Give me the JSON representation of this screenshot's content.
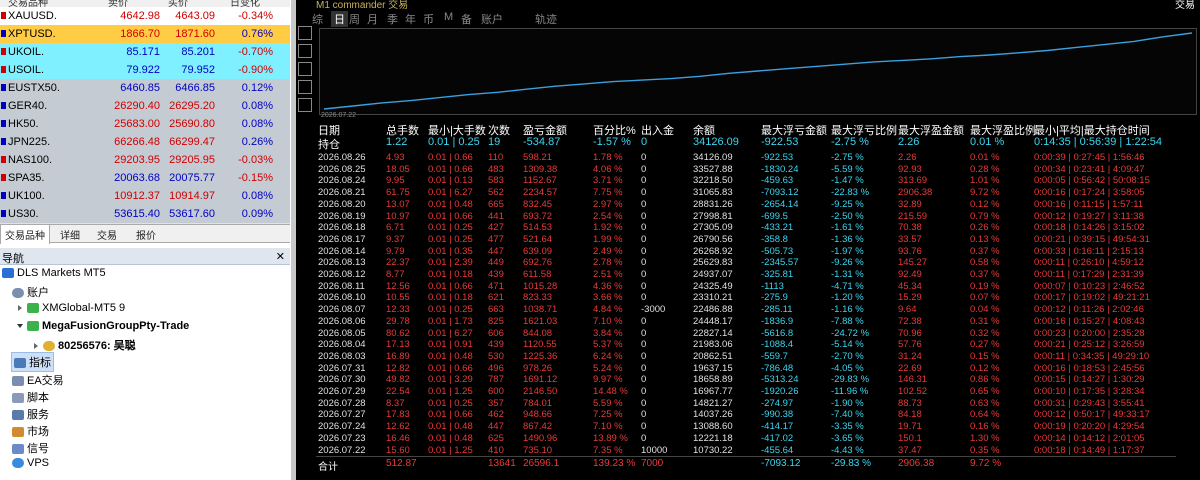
{
  "market_watch": {
    "headers": [
      "交易品种",
      "卖价",
      "买价",
      "日变化"
    ],
    "rows": [
      {
        "symbol": "XAUUSD.",
        "bid": "4642.98",
        "ask": "4643.09",
        "change": "-0.34%",
        "bg": "#ffffff",
        "bid_color": "#d00000",
        "ask_color": "#d00000",
        "chg_color": "#d00000"
      },
      {
        "symbol": "XPTUSD.",
        "bid": "1866.70",
        "ask": "1871.60",
        "change": "0.76%",
        "bg": "#ffcc44",
        "bid_color": "#d00000",
        "ask_color": "#d00000",
        "chg_color": "#0000c0"
      },
      {
        "symbol": "UKOIL.",
        "bid": "85.171",
        "ask": "85.201",
        "change": "-0.70%",
        "bg": "#7ff0ff",
        "bid_color": "#0000c0",
        "ask_color": "#0000c0",
        "chg_color": "#d00000"
      },
      {
        "symbol": "USOIL.",
        "bid": "79.922",
        "ask": "79.952",
        "change": "-0.90%",
        "bg": "#7ff0ff",
        "bid_color": "#0000c0",
        "ask_color": "#0000c0",
        "chg_color": "#d00000"
      },
      {
        "symbol": "EUSTX50.",
        "bid": "6460.85",
        "ask": "6466.85",
        "change": "0.12%",
        "bg": "#c4cbd3",
        "bid_color": "#0000c0",
        "ask_color": "#0000c0",
        "chg_color": "#0000c0"
      },
      {
        "symbol": "GER40.",
        "bid": "26290.40",
        "ask": "26295.20",
        "change": "0.08%",
        "bg": "#c4cbd3",
        "bid_color": "#d00000",
        "ask_color": "#d00000",
        "chg_color": "#0000c0"
      },
      {
        "symbol": "HK50.",
        "bid": "25683.00",
        "ask": "25690.80",
        "change": "0.08%",
        "bg": "#c4cbd3",
        "bid_color": "#d00000",
        "ask_color": "#d00000",
        "chg_color": "#0000c0"
      },
      {
        "symbol": "JPN225.",
        "bid": "66266.48",
        "ask": "66299.47",
        "change": "0.26%",
        "bg": "#c4cbd3",
        "bid_color": "#d00000",
        "ask_color": "#d00000",
        "chg_color": "#0000c0"
      },
      {
        "symbol": "NAS100.",
        "bid": "29203.95",
        "ask": "29205.95",
        "change": "-0.03%",
        "bg": "#c4cbd3",
        "bid_color": "#d00000",
        "ask_color": "#d00000",
        "chg_color": "#d00000"
      },
      {
        "symbol": "SPA35.",
        "bid": "20063.68",
        "ask": "20075.77",
        "change": "-0.15%",
        "bg": "#c4cbd3",
        "bid_color": "#0000c0",
        "ask_color": "#0000c0",
        "chg_color": "#d00000"
      },
      {
        "symbol": "UK100.",
        "bid": "10912.37",
        "ask": "10914.97",
        "change": "0.08%",
        "bg": "#c4cbd3",
        "bid_color": "#d00000",
        "ask_color": "#d00000",
        "chg_color": "#0000c0"
      },
      {
        "symbol": "US30.",
        "bid": "53615.40",
        "ask": "53617.60",
        "change": "0.09%",
        "bg": "#c4cbd3",
        "bid_color": "#0000c0",
        "ask_color": "#0000c0",
        "chg_color": "#0000c0"
      }
    ],
    "tabs": [
      "交易品种",
      "详细",
      "交易",
      "报价"
    ]
  },
  "navigator": {
    "title": "导航",
    "items": [
      {
        "label": "DLS Markets MT5",
        "bold": false
      },
      {
        "label": "账户",
        "bold": false
      },
      {
        "label": "XMGlobal-MT5 9",
        "bold": false
      },
      {
        "label": "MegaFusionGroupPty-Trade",
        "bold": true
      },
      {
        "label": "80256576: 吴聪",
        "bold": true
      },
      {
        "label": "指标",
        "bold": false
      },
      {
        "label": "EA交易",
        "bold": false
      },
      {
        "label": "脚本",
        "bold": false
      },
      {
        "label": "服务",
        "bold": false
      },
      {
        "label": "市场",
        "bold": false
      },
      {
        "label": "信号",
        "bold": false
      },
      {
        "label": "VPS",
        "bold": false
      }
    ]
  },
  "chart": {
    "title": "M1 commander 交易",
    "right": "交易",
    "periods": [
      "综",
      "日",
      "周",
      "月",
      "季",
      "年",
      "币",
      "M",
      "备",
      "账户",
      "轨迹"
    ],
    "equity_date": "2026.07.22",
    "equity_curve": [
      0,
      0.04,
      0.08,
      0.11,
      0.15,
      0.19,
      0.22,
      0.26,
      0.3,
      0.33,
      0.36,
      0.38,
      0.4,
      0.43,
      0.47,
      0.5,
      0.53,
      0.56,
      0.59,
      0.62,
      0.64,
      0.66,
      0.69,
      0.71,
      0.74,
      0.77,
      0.81,
      0.85,
      0.89,
      0.95,
      1.0
    ]
  },
  "table": {
    "headers": [
      "日期",
      "总手数",
      "最小|大手数",
      "次数",
      "盈亏金额",
      "百分比%",
      "出入金",
      "余额",
      "最大浮亏金额",
      "最大浮亏比例",
      "最大浮盈金额",
      "最大浮盈比例",
      "最小|平均|最大持仓时间"
    ],
    "hold": [
      "持仓",
      "1.22",
      "0.01 | 0.25",
      "19",
      "-534.87",
      "-1.57 %",
      "0",
      "34126.09",
      "-922.53",
      "-2.75 %",
      "2.26",
      "0.01 %",
      "0:14:35 | 0:56:39 | 1:22:54"
    ],
    "rows": [
      [
        "2026.08.26",
        "4.93",
        "0.01 | 0.66",
        "110",
        "598.21",
        "1.78 %",
        "0",
        "34126.09",
        "-922.53",
        "-2.75 %",
        "2.26",
        "0.01 %",
        "0:00:39 | 0:27:45 | 1:56:46"
      ],
      [
        "2026.08.25",
        "18.05",
        "0.01 | 0.66",
        "483",
        "1309.38",
        "4.06 %",
        "0",
        "33527.88",
        "-1830.24",
        "-5.59 %",
        "92.93",
        "0.28 %",
        "0:00:34 | 0:23:41 | 4:09:47"
      ],
      [
        "2026.08.24",
        "9.95",
        "0.01 | 0.13",
        "583",
        "1152.67",
        "3.71 %",
        "0",
        "32218.50",
        "-459.63",
        "-1.47 %",
        "313.69",
        "1.01 %",
        "0:00:05 | 0:56:42 | 50:08:15"
      ],
      [
        "2026.08.21",
        "61.75",
        "0.01 | 6.27",
        "562",
        "2234.57",
        "7.75 %",
        "0",
        "31065.83",
        "-7093.12",
        "-22.83 %",
        "2906.38",
        "9.72 %",
        "0:00:16 | 0:17:24 | 3:58:05"
      ],
      [
        "2026.08.20",
        "13.07",
        "0.01 | 0.48",
        "665",
        "832.45",
        "2.97 %",
        "0",
        "28831.26",
        "-2654.14",
        "-9.25 %",
        "32.89",
        "0.12 %",
        "0:00:16 | 0:11:15 | 1:57:11"
      ],
      [
        "2026.08.19",
        "10.97",
        "0.01 | 0.66",
        "441",
        "693.72",
        "2.54 %",
        "0",
        "27998.81",
        "-699.5",
        "-2.50 %",
        "215.59",
        "0.79 %",
        "0:00:12 | 0:19:27 | 3:11:38"
      ],
      [
        "2026.08.18",
        "6.71",
        "0.01 | 0.25",
        "427",
        "514.53",
        "1.92 %",
        "0",
        "27305.09",
        "-433.21",
        "-1.61 %",
        "70.38",
        "0.26 %",
        "0:00:18 | 0:14:26 | 3:15:02"
      ],
      [
        "2026.08.17",
        "9.37",
        "0.01 | 0.25",
        "477",
        "521.64",
        "1.99 %",
        "0",
        "26790.56",
        "-358.8",
        "-1.36 %",
        "33.57",
        "0.13 %",
        "0:00:21 | 0:39:15 | 49:54:31"
      ],
      [
        "2026.08.14",
        "9.79",
        "0.01 | 0.35",
        "447",
        "639.09",
        "2.49 %",
        "0",
        "26268.92",
        "-505.73",
        "-1.97 %",
        "93.76",
        "0.37 %",
        "0:00:33 | 0:16:11 | 2:15:13"
      ],
      [
        "2026.08.13",
        "22.37",
        "0.01 | 2.39",
        "449",
        "692.76",
        "2.78 %",
        "0",
        "25629.83",
        "-2345.57",
        "-9.26 %",
        "145.27",
        "0.58 %",
        "0:00:11 | 0:26:10 | 4:59:12"
      ],
      [
        "2026.08.12",
        "8.77",
        "0.01 | 0.18",
        "439",
        "611.58",
        "2.51 %",
        "0",
        "24937.07",
        "-325.81",
        "-1.31 %",
        "92.49",
        "0.37 %",
        "0:00:11 | 0:17:29 | 2:31:39"
      ],
      [
        "2026.08.11",
        "12.56",
        "0.01 | 0.66",
        "471",
        "1015.28",
        "4.36 %",
        "0",
        "24325.49",
        "-1113",
        "-4.71 %",
        "45.34",
        "0.19 %",
        "0:00:07 | 0:10:23 | 2:46:52"
      ],
      [
        "2026.08.10",
        "10.55",
        "0.01 | 0.18",
        "621",
        "823.33",
        "3.66 %",
        "0",
        "23310.21",
        "-275.9",
        "-1.20 %",
        "15.29",
        "0.07 %",
        "0:00:17 | 0:19:02 | 49:21:21"
      ],
      [
        "2026.08.07",
        "12.33",
        "0.01 | 0.25",
        "663",
        "1038.71",
        "4.84 %",
        "-3000",
        "22486.88",
        "-285.11",
        "-1.16 %",
        "9.64",
        "0.04 %",
        "0:00:12 | 0:11:26 | 2:02:46"
      ],
      [
        "2026.08.06",
        "29.78",
        "0.01 | 1.73",
        "825",
        "1621.03",
        "7.10 %",
        "0",
        "24448.17",
        "-1836.9",
        "-7.88 %",
        "72.38",
        "0.31 %",
        "0:00:16 | 0:15:27 | 4:08:43"
      ],
      [
        "2026.08.05",
        "80.62",
        "0.01 | 6.27",
        "606",
        "844.08",
        "3.84 %",
        "0",
        "22827.14",
        "-5616.8",
        "-24.72 %",
        "70.96",
        "0.32 %",
        "0:00:23 | 0:20:00 | 2:35:28"
      ],
      [
        "2026.08.04",
        "17.13",
        "0.01 | 0.91",
        "439",
        "1120.55",
        "5.37 %",
        "0",
        "21983.06",
        "-1088.4",
        "-5.14 %",
        "57.76",
        "0.27 %",
        "0:00:21 | 0:25:12 | 3:26:59"
      ],
      [
        "2026.08.03",
        "16.89",
        "0.01 | 0.48",
        "530",
        "1225.36",
        "6.24 %",
        "0",
        "20862.51",
        "-559.7",
        "-2.70 %",
        "31.24",
        "0.15 %",
        "0:00:11 | 0:34:35 | 49:29:10"
      ],
      [
        "2026.07.31",
        "12.82",
        "0.01 | 0.66",
        "496",
        "978.26",
        "5.24 %",
        "0",
        "19637.15",
        "-786.48",
        "-4.05 %",
        "22.69",
        "0.12 %",
        "0:00:16 | 0:18:53 | 2:45:56"
      ],
      [
        "2026.07.30",
        "49.82",
        "0.01 | 3.29",
        "787",
        "1691.12",
        "9.97 %",
        "0",
        "18658.89",
        "-5313.24",
        "-29.83 %",
        "146.31",
        "0.86 %",
        "0:00:15 | 0:14:27 | 1:30:29"
      ],
      [
        "2026.07.29",
        "22.54",
        "0.01 | 1.25",
        "600",
        "2146.50",
        "14.48 %",
        "0",
        "16967.77",
        "-1920.26",
        "-11.96 %",
        "102.52",
        "0.65 %",
        "0:00:10 | 0:17:35 | 3:28:34"
      ],
      [
        "2026.07.28",
        "8.37",
        "0.01 | 0.25",
        "357",
        "784.01",
        "5.59 %",
        "0",
        "14821.27",
        "-274.97",
        "-1.90 %",
        "88.73",
        "0.63 %",
        "0:00:31 | 0:29:43 | 3:55:41"
      ],
      [
        "2026.07.27",
        "17.83",
        "0.01 | 0.66",
        "462",
        "948.66",
        "7.25 %",
        "0",
        "14037.26",
        "-990.38",
        "-7.40 %",
        "84.18",
        "0.64 %",
        "0:00:12 | 0:50:17 | 49:33:17"
      ],
      [
        "2026.07.24",
        "12.62",
        "0.01 | 0.48",
        "447",
        "867.42",
        "7.10 %",
        "0",
        "13088.60",
        "-414.17",
        "-3.35 %",
        "19.71",
        "0.16 %",
        "0:00:19 | 0:20:20 | 4:29:54"
      ],
      [
        "2026.07.23",
        "16.46",
        "0.01 | 0.48",
        "625",
        "1490.96",
        "13.89 %",
        "0",
        "12221.18",
        "-417.02",
        "-3.65 %",
        "150.1",
        "1.30 %",
        "0:00:14 | 0:14:12 | 2:01:05"
      ],
      [
        "2026.07.22",
        "15.60",
        "0.01 | 1.25",
        "410",
        "735.10",
        "7.35 %",
        "10000",
        "10730.22",
        "-455.64",
        "-4.43 %",
        "37.47",
        "0.35 %",
        "0:00:18 | 0:14:49 | 1:17:37"
      ]
    ],
    "total": [
      "合计",
      "512.87",
      "",
      "13641",
      "26596.1",
      "139.23 %",
      "7000",
      "",
      "-7093.12",
      "-29.83 %",
      "2906.38",
      "9.72 %",
      ""
    ]
  },
  "colors": {
    "header_white": "#ffffff",
    "date_white": "#e0e0e0",
    "red": "#e83a3a",
    "cyan": "#3bd6f0",
    "curve": "#3aa0e0"
  }
}
